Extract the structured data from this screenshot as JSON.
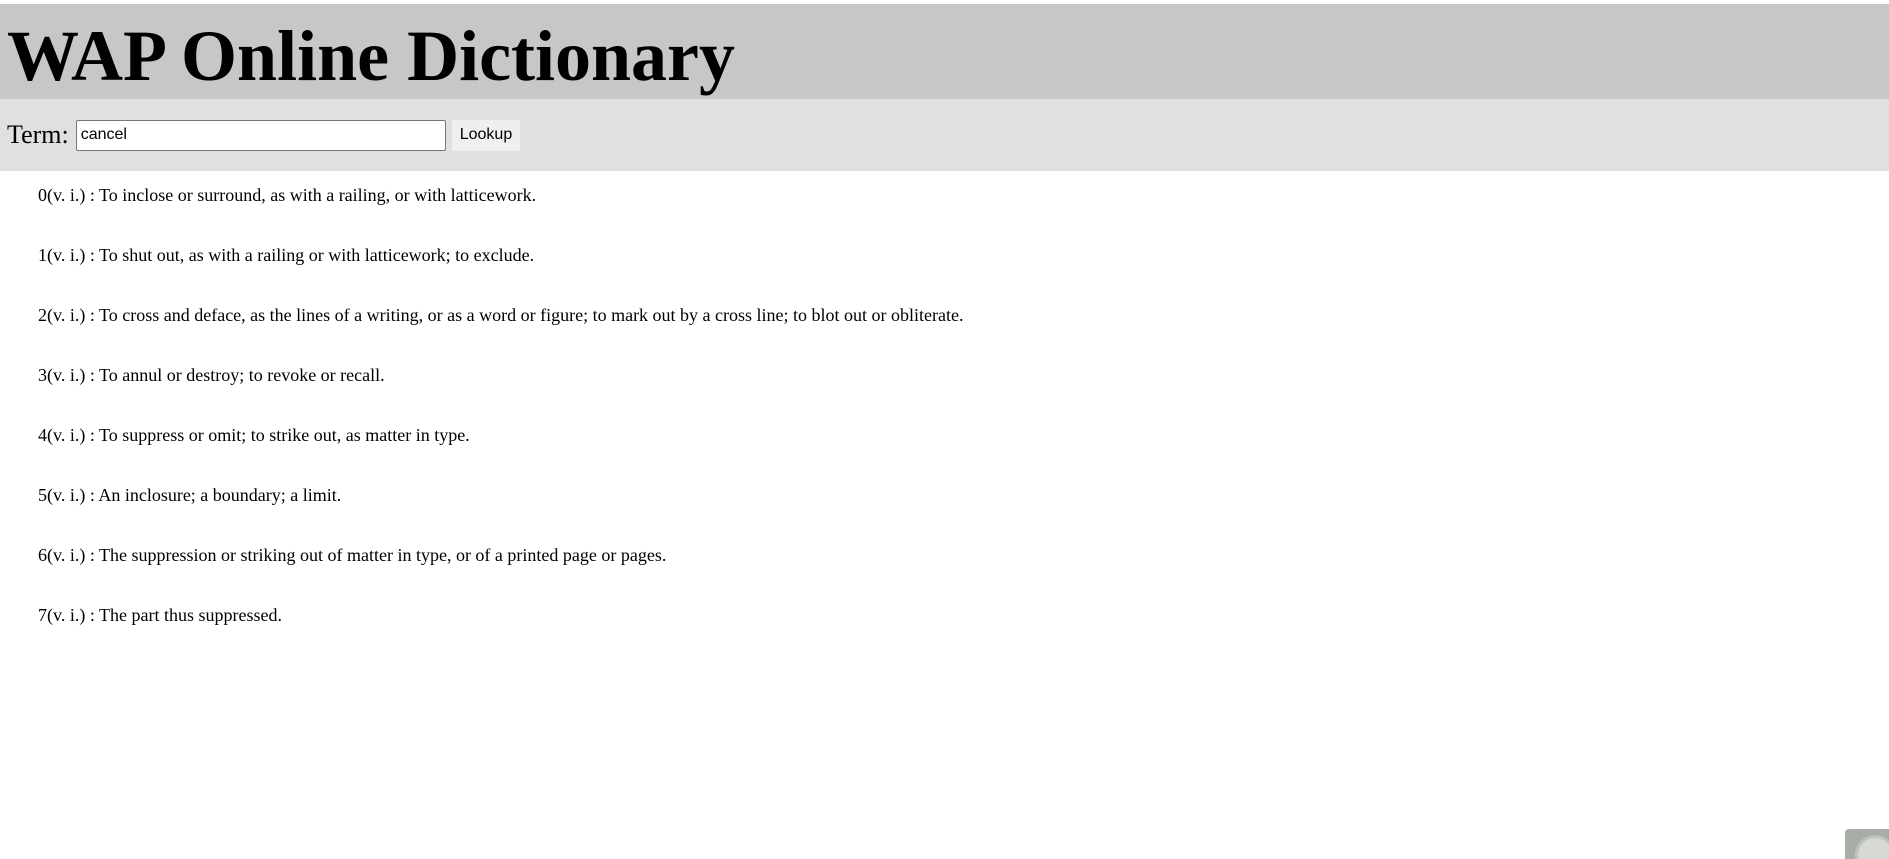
{
  "header": {
    "title": "WAP Online Dictionary"
  },
  "search": {
    "label": "Term:",
    "value": "cancel",
    "button_label": "Lookup"
  },
  "definitions": [
    {
      "text": "0(v. i.) : To inclose or surround, as with a railing, or with latticework."
    },
    {
      "text": "1(v. i.) : To shut out, as with a railing or with latticework; to exclude."
    },
    {
      "text": "2(v. i.) : To cross and deface, as the lines of a writing, or as a word or figure; to mark out by a cross line; to blot out or obliterate."
    },
    {
      "text": "3(v. i.) : To annul or destroy; to revoke or recall."
    },
    {
      "text": "4(v. i.) : To suppress or omit; to strike out, as matter in type."
    },
    {
      "text": "5(v. i.) : An inclosure; a boundary; a limit."
    },
    {
      "text": "6(v. i.) : The suppression or striking out of matter in type, or of a printed page or pages."
    },
    {
      "text": "7(v. i.) : The part thus suppressed."
    }
  ]
}
